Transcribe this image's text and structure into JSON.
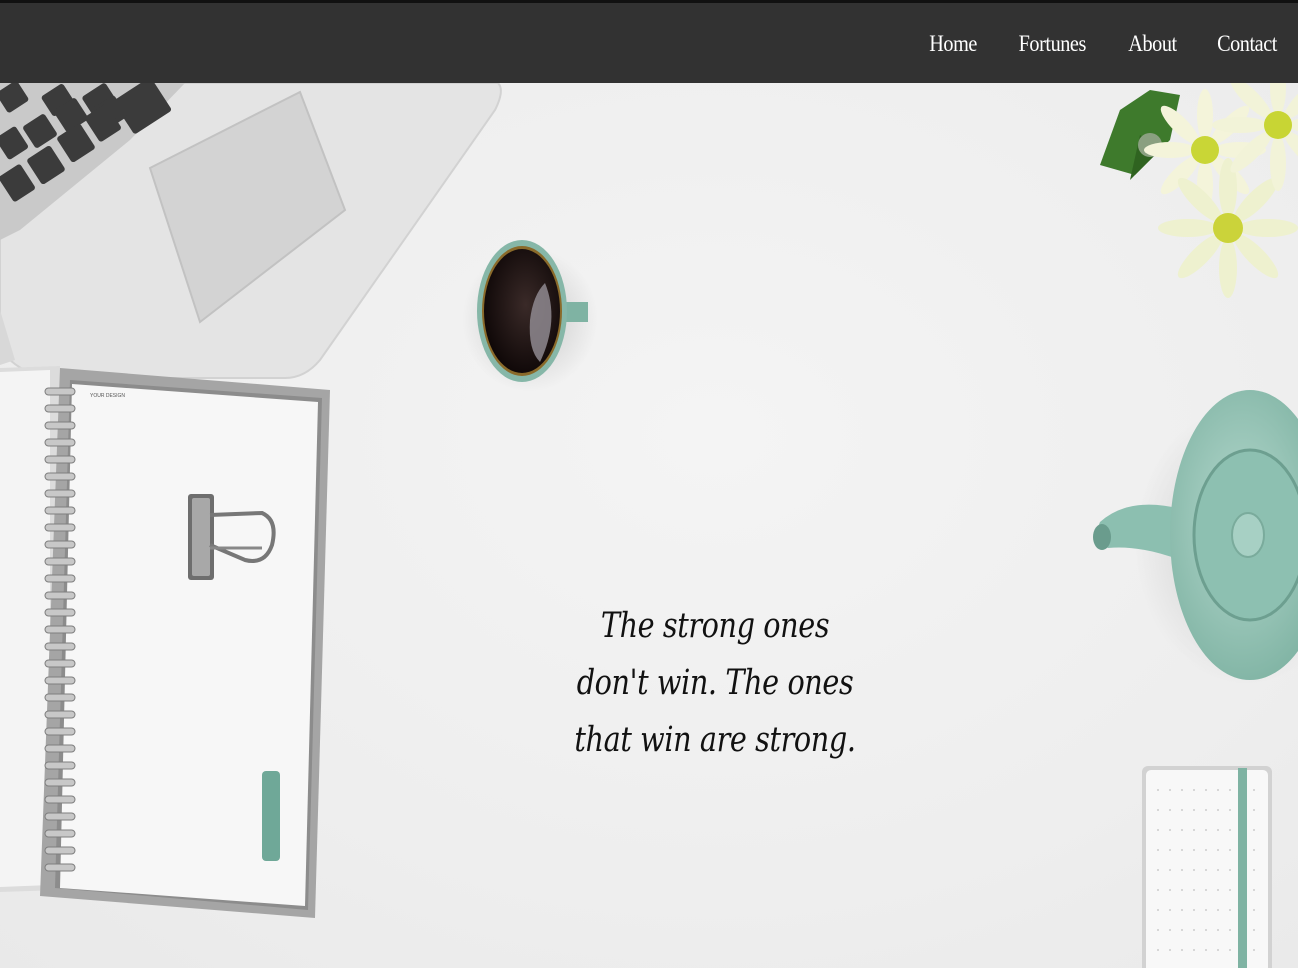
{
  "nav": {
    "items": [
      {
        "label": "Home"
      },
      {
        "label": "Fortunes"
      },
      {
        "label": "About"
      },
      {
        "label": "Contact"
      }
    ]
  },
  "hero": {
    "quote": "The strong ones don't win. The ones that win are strong.",
    "notebook_label": "YOUR DESIGN"
  },
  "colors": {
    "navbar": "#323232",
    "accent_teal": "#7fb3a3",
    "desk": "#efefef"
  }
}
